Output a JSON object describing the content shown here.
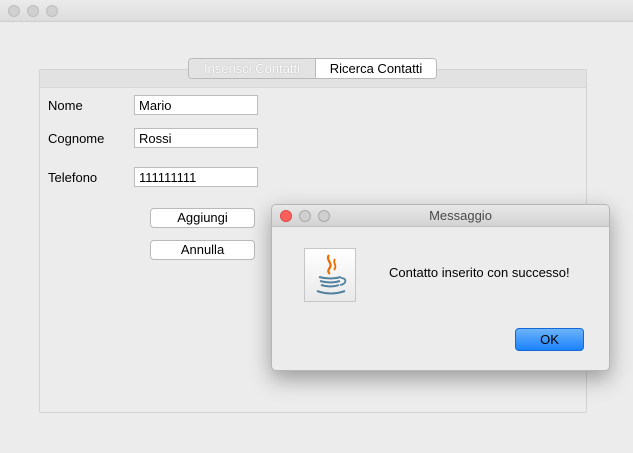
{
  "tabs": [
    {
      "label": "Inserisci Contatti",
      "active": false
    },
    {
      "label": "Ricerca Contatti",
      "active": true
    }
  ],
  "form": {
    "nome_label": "Nome",
    "nome_value": "Mario",
    "cognome_label": "Cognome",
    "cognome_value": "Rossi",
    "telefono_label": "Telefono",
    "telefono_value": "111111111",
    "add_label": "Aggiungi",
    "cancel_label": "Annulla"
  },
  "dialog": {
    "title": "Messaggio",
    "message": "Contatto inserito con successo!",
    "ok_label": "OK",
    "icon": "java-cup-icon"
  },
  "colors": {
    "window_bg": "#ececec",
    "ok_button": "#1a82fb",
    "close_red": "#fc605b"
  }
}
